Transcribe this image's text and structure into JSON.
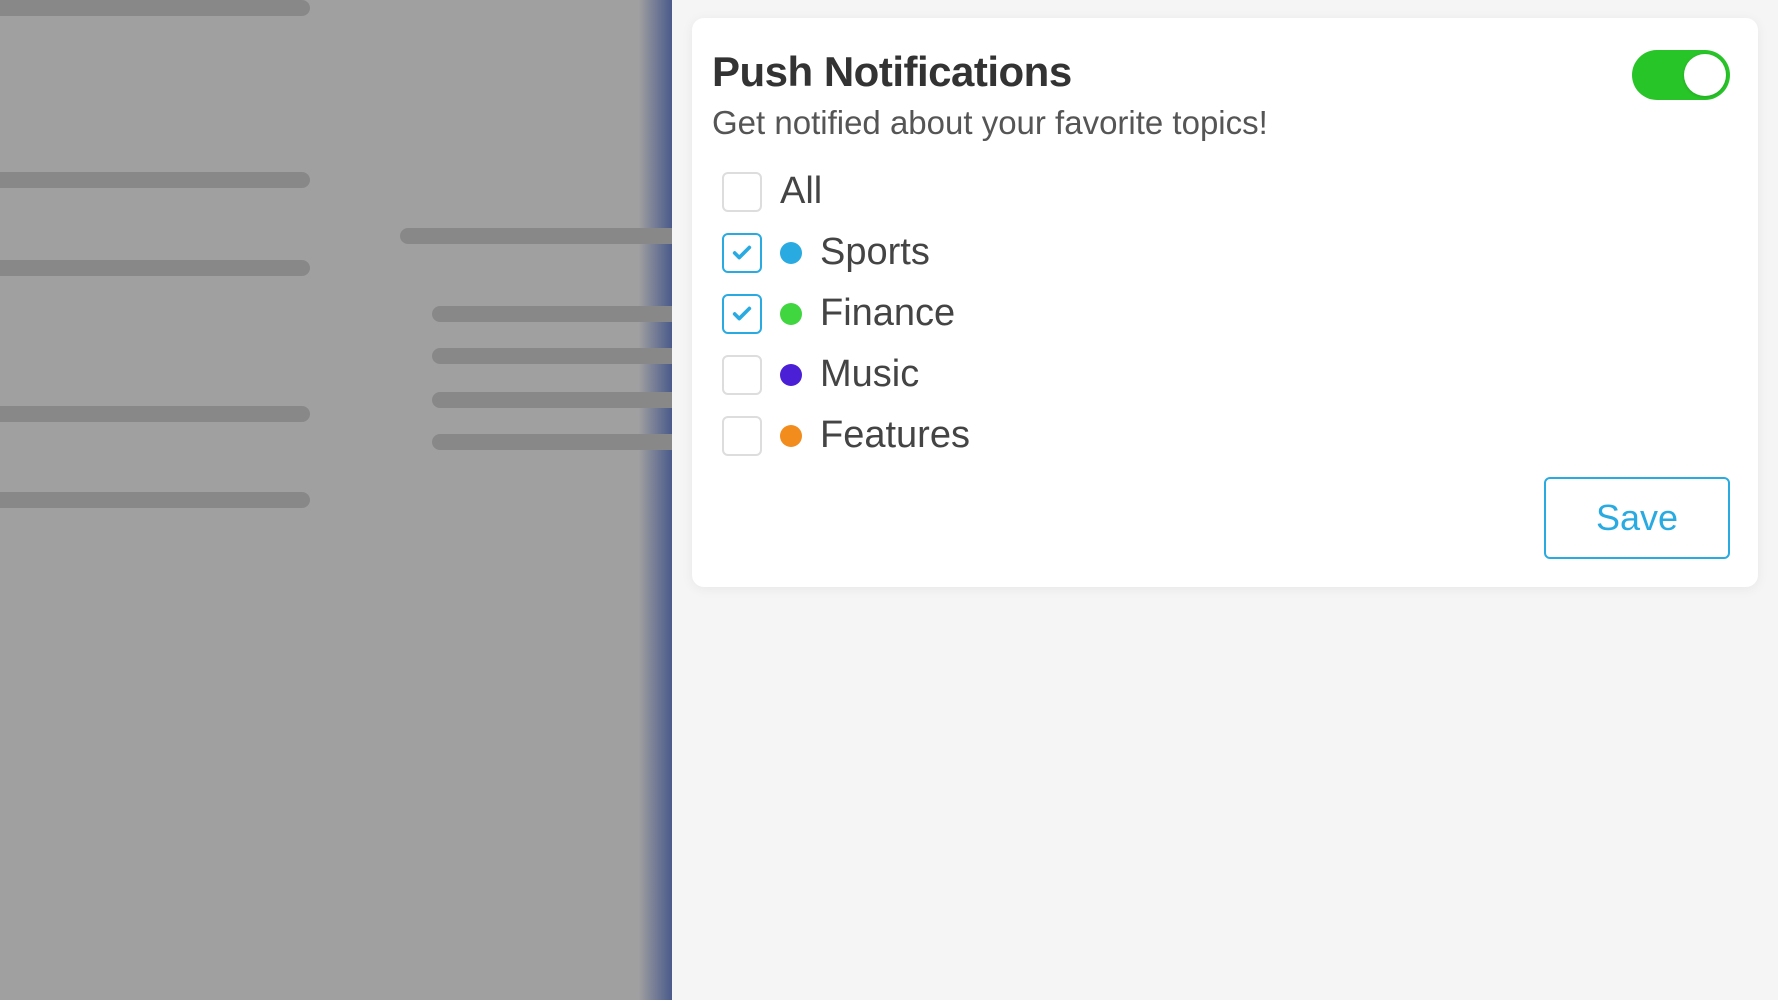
{
  "card": {
    "title": "Push Notifications",
    "subtitle": "Get notified about your favorite topics!",
    "toggle_on": true,
    "save_label": "Save"
  },
  "topics": [
    {
      "label": "All",
      "checked": false,
      "dot_color": null
    },
    {
      "label": "Sports",
      "checked": true,
      "dot_color": "#29abe2"
    },
    {
      "label": "Finance",
      "checked": true,
      "dot_color": "#3fd63f"
    },
    {
      "label": "Music",
      "checked": false,
      "dot_color": "#4a1fd6"
    },
    {
      "label": "Features",
      "checked": false,
      "dot_color": "#f28c1d"
    }
  ],
  "colors": {
    "accent": "#29abe2",
    "toggle_on": "#28c528"
  }
}
